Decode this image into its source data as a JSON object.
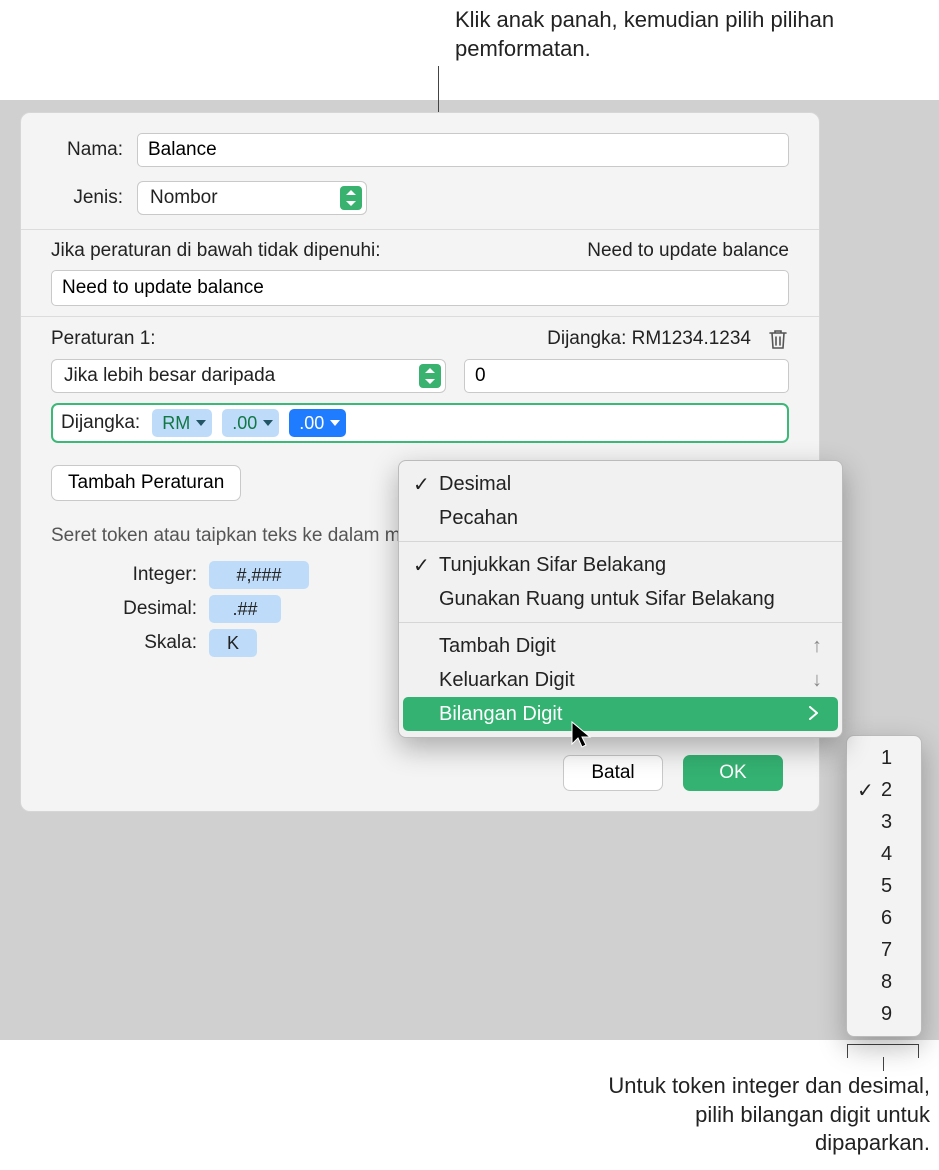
{
  "callouts": {
    "top": "Klik anak panah, kemudian pilih pilihan pemformatan.",
    "bottom": "Untuk token integer dan desimal, pilih bilangan digit untuk dipaparkan."
  },
  "form": {
    "name_label": "Nama:",
    "name_value": "Balance",
    "type_label": "Jenis:",
    "type_value": "Nombor"
  },
  "condition": {
    "header": "Jika peraturan di bawah tidak dipenuhi:",
    "preview": "Need to update balance",
    "input_value": "Need to update balance"
  },
  "rule1": {
    "label": "Peraturan 1:",
    "expected": "Dijangka: RM1234.1234",
    "operator": "Jika lebih besar daripada",
    "value": "0",
    "token_label": "Dijangka:",
    "pill_currency": "RM",
    "pill_decimals1": ".00",
    "pill_decimals2": ".00"
  },
  "add_rule": "Tambah Peraturan",
  "drag_hint": "Seret token atau taipkan teks ke dalam medan di atas",
  "tokens": {
    "integer_label": "Integer:",
    "integer_value": "#,###",
    "decimal_label": "Desimal:",
    "decimal_value": ".##",
    "scale_label": "Skala:",
    "scale_value": "K"
  },
  "buttons": {
    "cancel": "Batal",
    "ok": "OK"
  },
  "menu": {
    "decimal": "Desimal",
    "fraction": "Pecahan",
    "show_trailing": "Tunjukkan Sifar Belakang",
    "use_space": "Gunakan Ruang untuk Sifar Belakang",
    "add_digit": "Tambah Digit",
    "remove_digit": "Keluarkan Digit",
    "digit_count": "Bilangan Digit",
    "shortcut_up": "↑",
    "shortcut_down": "↓"
  },
  "submenu": {
    "items": [
      "1",
      "2",
      "3",
      "4",
      "5",
      "6",
      "7",
      "8",
      "9"
    ],
    "selected": "2"
  }
}
